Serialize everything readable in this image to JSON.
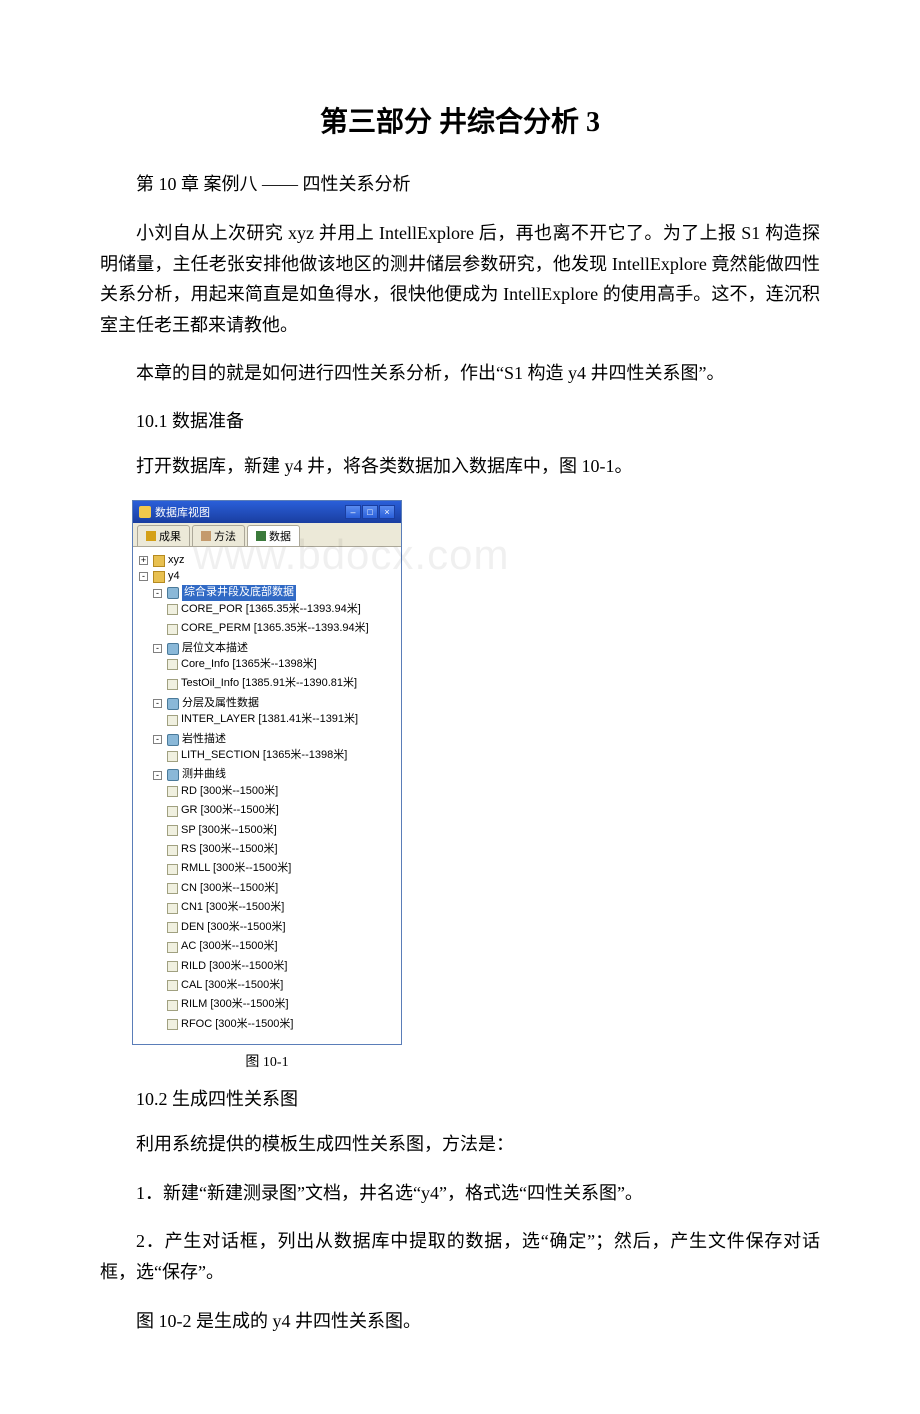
{
  "title": "第三部分 井综合分析 3",
  "chapter": "第 10 章 案例八 —— 四性关系分析",
  "para1": "小刘自从上次研究 xyz 并用上 IntellExplore 后，再也离不开它了。为了上报 S1 构造探明储量，主任老张安排他做该地区的测井储层参数研究，他发现 IntellExplore 竟然能做四性关系分析，用起来简直是如鱼得水，很快他便成为 IntellExplore 的使用高手。这不，连沉积室主任老王都来请教他。",
  "para2": "本章的目的就是如何进行四性关系分析，作出“S1 构造 y4 井四性关系图”。",
  "section10_1": "10.1 数据准备",
  "para3": "打开数据库，新建 y4 井，将各类数据加入数据库中，图 10-1。",
  "window": {
    "title": "数据库视图",
    "controls": {
      "min": "–",
      "max": "□",
      "close": "×"
    },
    "tabs": {
      "result": "成果",
      "method": "方法",
      "data": "数据"
    },
    "watermark": "www.bdocx.com",
    "root1": "xyz",
    "root2": "y4",
    "groups": {
      "g1": {
        "label": "综合录井段及底部数据",
        "items": [
          "CORE_POR [1365.35米--1393.94米]",
          "CORE_PERM [1365.35米--1393.94米]"
        ]
      },
      "g2": {
        "label": "层位文本描述",
        "items": [
          "Core_Info [1365米--1398米]",
          "TestOil_Info [1385.91米--1390.81米]"
        ]
      },
      "g3": {
        "label": "分层及属性数据",
        "items": [
          "INTER_LAYER [1381.41米--1391米]"
        ]
      },
      "g4": {
        "label": "岩性描述",
        "items": [
          "LITH_SECTION [1365米--1398米]"
        ]
      },
      "g5": {
        "label": "测井曲线",
        "items": [
          "RD [300米--1500米]",
          "GR [300米--1500米]",
          "SP [300米--1500米]",
          "RS [300米--1500米]",
          "RMLL [300米--1500米]",
          "CN [300米--1500米]",
          "CN1 [300米--1500米]",
          "DEN [300米--1500米]",
          "AC [300米--1500米]",
          "RILD [300米--1500米]",
          "CAL [300米--1500米]",
          "RILM [300米--1500米]",
          "RFOC [300米--1500米]"
        ]
      }
    }
  },
  "figure_caption": "图 10-1",
  "section10_2": "10.2 生成四性关系图",
  "para4": "利用系统提供的模板生成四性关系图，方法是：",
  "step1": "1．新建“新建测录图”文档，井名选“y4”，格式选“四性关系图”。",
  "step2": "2．产生对话框，列出从数据库中提取的数据，选“确定”；然后，产生文件保存对话框，选“保存”。",
  "para5": "图 10-2 是生成的 y4 井四性关系图。"
}
